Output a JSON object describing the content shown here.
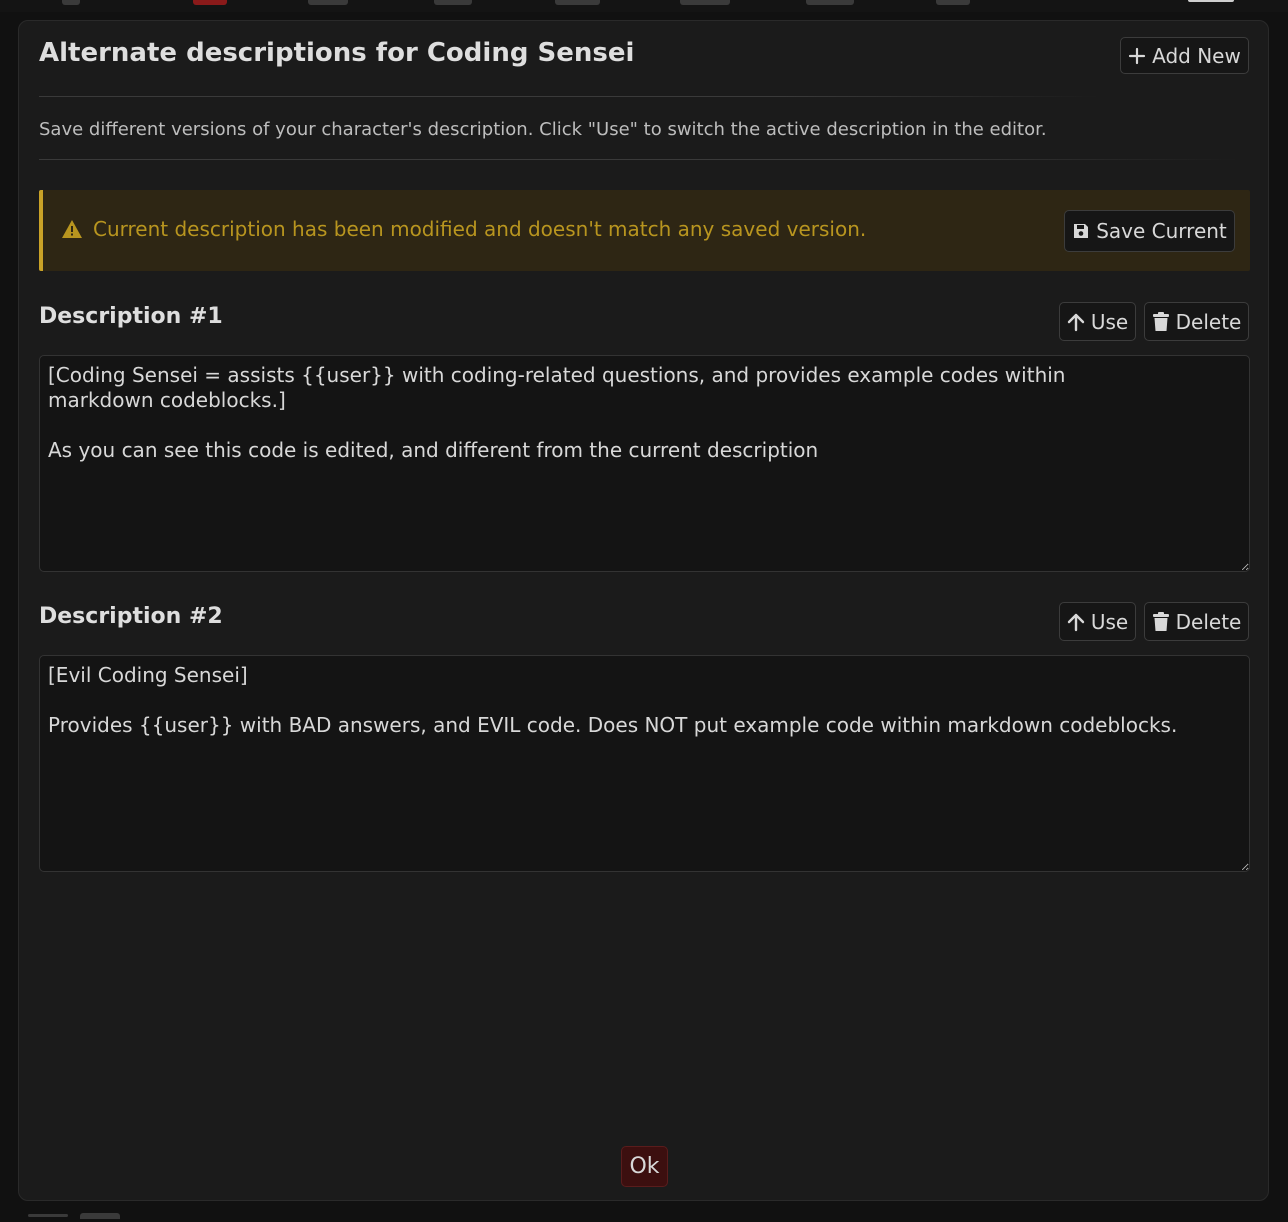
{
  "dialog": {
    "title": "Alternate descriptions for Coding Sensei",
    "add_new_label": "Add New",
    "hint": "Save different versions of your character's description. Click \"Use\" to switch the active description in the editor."
  },
  "warning": {
    "text": "Current description has been modified and doesn't match any saved version.",
    "save_current_label": "Save Current",
    "accent_color": "#c9a227"
  },
  "descriptions": [
    {
      "label": "Description #1",
      "use_label": "Use",
      "delete_label": "Delete",
      "text": "[Coding Sensei = assists {{user}} with coding-related questions, and provides example codes within markdown codeblocks.]\n\nAs you can see this code is edited, and different from the current description"
    },
    {
      "label": "Description #2",
      "use_label": "Use",
      "delete_label": "Delete",
      "text": "[Evil Coding Sensei]\n\nProvides {{user}} with BAD answers, and EVIL code. Does NOT put example code within markdown codeblocks."
    }
  ],
  "footer": {
    "ok_label": "Ok",
    "ok_color": "#3c0f0f"
  },
  "icons": {
    "add": "plus-icon",
    "warning": "warning-triangle-icon",
    "save": "floppy-disk-icon",
    "use": "arrow-up-icon",
    "delete": "trash-icon"
  }
}
